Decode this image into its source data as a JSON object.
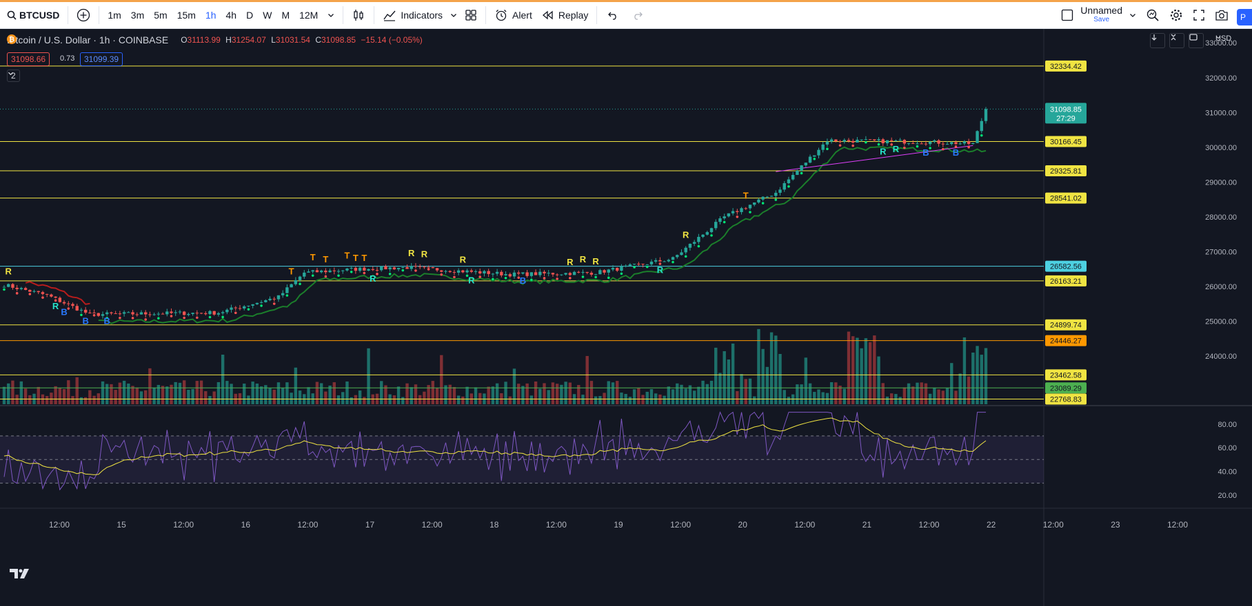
{
  "toolbar": {
    "symbol": "BTCUSD",
    "intervals": [
      "1m",
      "3m",
      "5m",
      "15m",
      "1h",
      "4h",
      "D",
      "W",
      "M",
      "12M"
    ],
    "active_interval": "1h",
    "indicators_label": "Indicators",
    "alert_label": "Alert",
    "replay_label": "Replay",
    "layout_name": "Unnamed",
    "save_label": "Save",
    "pill_label": "P"
  },
  "legend": {
    "title": "Bitcoin / U.S. Dollar · 1h · COINBASE",
    "open_key": "O",
    "open": "31113.99",
    "high_key": "H",
    "high": "31254.07",
    "low_key": "L",
    "low": "31031.54",
    "close_key": "C",
    "close": "31098.85",
    "change": "−15.14 (−0.05%)",
    "sell_price": "31098.66",
    "spread": "0.73",
    "buy_price": "31099.39",
    "indicators_toggle": "2"
  },
  "scale": {
    "currency": "USD"
  },
  "colors": {
    "background": "#131722",
    "up": "#26a69a",
    "down": "#ef5350",
    "level_line": "#f0e442",
    "level_line_cyan": "#4dd0e1",
    "level_line_orange": "#ff9800",
    "level_line_green": "#4caf50",
    "trend_green": "#1b7e2b",
    "trend_red": "#b71c1c",
    "rsi": "#7e57c2",
    "rsi_ma": "#f0e442",
    "last_price": "#26a69a"
  },
  "chart_data": [
    {
      "type": "candlestick",
      "pane": "price",
      "scale": "right",
      "ylim": [
        22600,
        33400
      ],
      "y_ticks": [
        33000,
        32000,
        31000,
        30000,
        29000,
        28000,
        27000,
        26000,
        25000,
        24000
      ],
      "y_tick_labels": [
        "33000.00",
        "32000.00",
        "31000.00",
        "30000.00",
        "29000.00",
        "28000.00",
        "27000.00",
        "26000.00",
        "25000.00",
        "24000.00"
      ],
      "x_tick_labels": [
        "12:00",
        "15",
        "12:00",
        "16",
        "12:00",
        "17",
        "12:00",
        "18",
        "12:00",
        "19",
        "12:00",
        "20",
        "12:00",
        "21",
        "12:00",
        "22",
        "12:00",
        "23",
        "12:00"
      ],
      "last_price": 31098.85,
      "last_price_label": "31098.85",
      "countdown_label": "27:29",
      "horizontal_levels": [
        {
          "price": 32334.42,
          "label": "32334.42",
          "color": "#f0e442"
        },
        {
          "price": 30166.45,
          "label": "30166.45",
          "color": "#f0e442"
        },
        {
          "price": 29325.81,
          "label": "29325.81",
          "color": "#f0e442"
        },
        {
          "price": 28541.02,
          "label": "28541.02",
          "color": "#f0e442"
        },
        {
          "price": 26582.56,
          "label": "26582.56",
          "color": "#4dd0e1"
        },
        {
          "price": 26163.21,
          "label": "26163.21",
          "color": "#f0e442"
        },
        {
          "price": 24899.74,
          "label": "24899.74",
          "color": "#f0e442"
        },
        {
          "price": 24446.27,
          "label": "24446.27",
          "color": "#ff9800"
        },
        {
          "price": 23462.58,
          "label": "23462.58",
          "color": "#f0e442"
        },
        {
          "price": 23089.29,
          "label": "23089.29",
          "color": "#4caf50"
        },
        {
          "price": 22768.83,
          "label": "22768.83",
          "color": "#f0e442"
        }
      ],
      "trend_anchors": [
        {
          "day": "14 (00:00)",
          "close": 26050
        },
        {
          "day": "14 (10:00)",
          "close": 25750
        },
        {
          "day": "14 (20:00)",
          "close": 25200
        },
        {
          "day": "15 (16:00)",
          "close": 25250
        },
        {
          "day": "16 (06:00)",
          "close": 25700
        },
        {
          "day": "16 (12:00)",
          "close": 26400
        },
        {
          "day": "17 (00:00)",
          "close": 26500
        },
        {
          "day": "17 (12:00)",
          "close": 26550
        },
        {
          "day": "18 (12:00)",
          "close": 26350
        },
        {
          "day": "19 (08:00)",
          "close": 26400
        },
        {
          "day": "20 (00:00)",
          "close": 26800
        },
        {
          "day": "20 (12:00)",
          "close": 28000
        },
        {
          "day": "21 (00:00)",
          "close": 28700
        },
        {
          "day": "21 (12:00)",
          "close": 30200
        },
        {
          "day": "22 (12:00)",
          "close": 30150
        },
        {
          "day": "23 (06:00)",
          "close": 30100
        },
        {
          "day": "23 (12:00)",
          "close": 31100
        }
      ],
      "signal_markers": [
        {
          "text": "R",
          "color": "#f0e442"
        },
        {
          "text": "R",
          "color": "#26e3c9"
        },
        {
          "text": "B",
          "color": "#2979ff"
        },
        {
          "text": "B",
          "color": "#2979ff"
        },
        {
          "text": "B",
          "color": "#2979ff"
        },
        {
          "text": "T",
          "color": "#ff9800"
        },
        {
          "text": "T",
          "color": "#ff9800"
        },
        {
          "text": "T",
          "color": "#ff9800"
        },
        {
          "text": "T",
          "color": "#ff9800"
        },
        {
          "text": "T",
          "color": "#ff9800"
        },
        {
          "text": "T",
          "color": "#ff9800"
        },
        {
          "text": "R",
          "color": "#26e3c9"
        },
        {
          "text": "R",
          "color": "#f0e442"
        },
        {
          "text": "R",
          "color": "#f0e442"
        },
        {
          "text": "R",
          "color": "#f0e442"
        },
        {
          "text": "R",
          "color": "#26e3c9"
        },
        {
          "text": "B",
          "color": "#2979ff"
        },
        {
          "text": "R",
          "color": "#f0e442"
        },
        {
          "text": "R",
          "color": "#f0e442"
        },
        {
          "text": "R",
          "color": "#f0e442"
        },
        {
          "text": "R",
          "color": "#26e3c9"
        },
        {
          "text": "R",
          "color": "#f0e442"
        },
        {
          "text": "T",
          "color": "#ff9800"
        },
        {
          "text": "R",
          "color": "#26e3c9"
        },
        {
          "text": "R",
          "color": "#26e3c9"
        },
        {
          "text": "B",
          "color": "#2979ff"
        },
        {
          "text": "B",
          "color": "#2979ff"
        }
      ]
    },
    {
      "type": "bar",
      "pane": "volume",
      "series": [
        {
          "name": "Volume",
          "up_color": "#26a69a",
          "down_color": "#ef5350"
        }
      ]
    },
    {
      "type": "line",
      "pane": "rsi",
      "ylim": [
        10,
        95
      ],
      "y_ticks": [
        80,
        60,
        40,
        20
      ],
      "y_tick_labels": [
        "80.00",
        "60.00",
        "40.00",
        "20.00"
      ],
      "band": [
        30,
        70
      ],
      "middle": 50,
      "series": [
        {
          "name": "RSI",
          "color": "#7e57c2"
        },
        {
          "name": "RSI-based MA",
          "color": "#f0e442"
        }
      ]
    }
  ]
}
